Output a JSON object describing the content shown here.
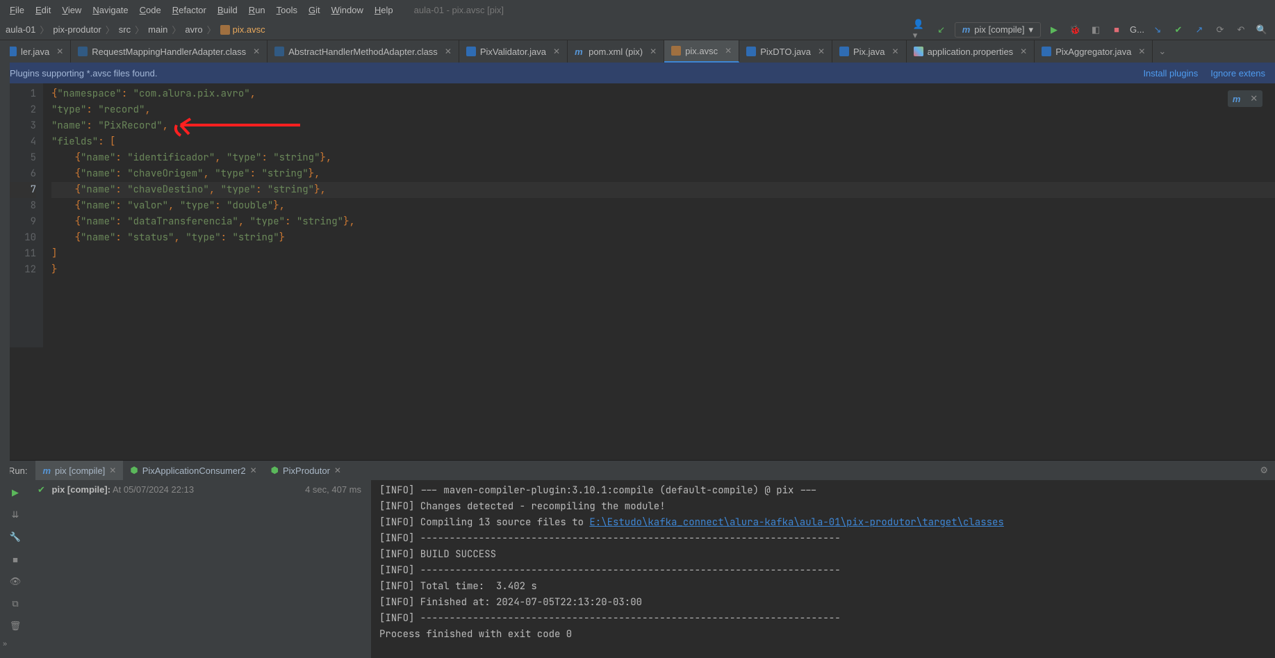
{
  "menubar": {
    "items": [
      "File",
      "Edit",
      "View",
      "Navigate",
      "Code",
      "Refactor",
      "Build",
      "Run",
      "Tools",
      "Git",
      "Window",
      "Help"
    ],
    "title": "aula-01 - pix.avsc [pix]"
  },
  "breadcrumbs": {
    "items": [
      "aula-01",
      "pix-produtor",
      "src",
      "main",
      "avro",
      "pix.avsc"
    ]
  },
  "run_config": {
    "label": "pix [compile]"
  },
  "toolbar_dropdown": "G...",
  "tabs": [
    {
      "label": "ler.java"
    },
    {
      "label": "RequestMappingHandlerAdapter.class"
    },
    {
      "label": "AbstractHandlerMethodAdapter.class"
    },
    {
      "label": "PixValidator.java"
    },
    {
      "label": "pom.xml (pix)"
    },
    {
      "label": "pix.avsc",
      "active": true
    },
    {
      "label": "PixDTO.java"
    },
    {
      "label": "Pix.java"
    },
    {
      "label": "application.properties"
    },
    {
      "label": "PixAggregator.java"
    }
  ],
  "banner": {
    "text": "Plugins supporting *.avsc files found.",
    "install": "Install plugins",
    "ignore": "Ignore extens"
  },
  "editor": {
    "lines": [
      {
        "n": 1,
        "segs": [
          [
            "pun",
            "{"
          ],
          [
            "str",
            "\"namespace\""
          ],
          [
            "pun",
            ": "
          ],
          [
            "str",
            "\"com.alura.pix.avro\""
          ],
          [
            "pun",
            ","
          ]
        ]
      },
      {
        "n": 2,
        "segs": [
          [
            "str",
            "\"type\""
          ],
          [
            "pun",
            ": "
          ],
          [
            "str",
            "\"record\""
          ],
          [
            "pun",
            ","
          ]
        ]
      },
      {
        "n": 3,
        "segs": [
          [
            "str",
            "\"name\""
          ],
          [
            "pun",
            ": "
          ],
          [
            "str",
            "\"PixRecord\""
          ],
          [
            "pun",
            ","
          ]
        ]
      },
      {
        "n": 4,
        "segs": [
          [
            "str",
            "\"fields\""
          ],
          [
            "pun",
            ": ["
          ]
        ]
      },
      {
        "n": 5,
        "segs": [
          [
            "plain",
            "    "
          ],
          [
            "pun",
            "{"
          ],
          [
            "str",
            "\"name\""
          ],
          [
            "pun",
            ": "
          ],
          [
            "str",
            "\"identificador\""
          ],
          [
            "pun",
            ", "
          ],
          [
            "str",
            "\"type\""
          ],
          [
            "pun",
            ": "
          ],
          [
            "str",
            "\"string\""
          ],
          [
            "pun",
            "},"
          ]
        ]
      },
      {
        "n": 6,
        "segs": [
          [
            "plain",
            "    "
          ],
          [
            "pun",
            "{"
          ],
          [
            "str",
            "\"name\""
          ],
          [
            "pun",
            ": "
          ],
          [
            "str",
            "\"chaveOrigem\""
          ],
          [
            "pun",
            ", "
          ],
          [
            "str",
            "\"type\""
          ],
          [
            "pun",
            ": "
          ],
          [
            "str",
            "\"string\""
          ],
          [
            "pun",
            "},"
          ]
        ]
      },
      {
        "n": 7,
        "hl": true,
        "segs": [
          [
            "plain",
            "    "
          ],
          [
            "pun",
            "{"
          ],
          [
            "str",
            "\"name\""
          ],
          [
            "pun",
            ": "
          ],
          [
            "str",
            "\"chaveDestino\""
          ],
          [
            "pun",
            ", "
          ],
          [
            "str",
            "\"type\""
          ],
          [
            "pun",
            ": "
          ],
          [
            "str",
            "\"string\""
          ],
          [
            "pun",
            "},"
          ]
        ]
      },
      {
        "n": 8,
        "segs": [
          [
            "plain",
            "    "
          ],
          [
            "pun",
            "{"
          ],
          [
            "str",
            "\"name\""
          ],
          [
            "pun",
            ": "
          ],
          [
            "str",
            "\"valor\""
          ],
          [
            "pun",
            ", "
          ],
          [
            "str",
            "\"type\""
          ],
          [
            "pun",
            ": "
          ],
          [
            "str",
            "\"double\""
          ],
          [
            "pun",
            "},"
          ]
        ]
      },
      {
        "n": 9,
        "segs": [
          [
            "plain",
            "    "
          ],
          [
            "pun",
            "{"
          ],
          [
            "str",
            "\"name\""
          ],
          [
            "pun",
            ": "
          ],
          [
            "str",
            "\"dataTransferencia\""
          ],
          [
            "pun",
            ", "
          ],
          [
            "str",
            "\"type\""
          ],
          [
            "pun",
            ": "
          ],
          [
            "str",
            "\"string\""
          ],
          [
            "pun",
            "},"
          ]
        ]
      },
      {
        "n": 10,
        "segs": [
          [
            "plain",
            "    "
          ],
          [
            "pun",
            "{"
          ],
          [
            "str",
            "\"name\""
          ],
          [
            "pun",
            ": "
          ],
          [
            "str",
            "\"status\""
          ],
          [
            "pun",
            ", "
          ],
          [
            "str",
            "\"type\""
          ],
          [
            "pun",
            ": "
          ],
          [
            "str",
            "\"string\""
          ],
          [
            "pun",
            "}"
          ]
        ]
      },
      {
        "n": 11,
        "segs": [
          [
            "pun",
            "]"
          ]
        ]
      },
      {
        "n": 12,
        "segs": [
          [
            "pun",
            "}"
          ]
        ]
      }
    ]
  },
  "run": {
    "label": "Run:",
    "tabs": [
      {
        "label": "pix [compile]",
        "icon": "m",
        "active": true
      },
      {
        "label": "PixApplicationConsumer2",
        "icon": "sb"
      },
      {
        "label": "PixProdutor",
        "icon": "sb"
      }
    ],
    "tree": {
      "title": "pix [compile]:",
      "status": "At 05/07/2024 22:13",
      "elapsed": "4 sec, 407 ms"
    },
    "console": [
      {
        "t": "[INFO] --- maven-compiler-plugin:3.10.1:compile (default-compile) @ pix ---"
      },
      {
        "t": "[INFO] Changes detected - recompiling the module!"
      },
      {
        "prefix": "[INFO] Compiling 13 source files to ",
        "link": "E:\\Estudo\\kafka_connect\\alura-kafka\\aula-01\\pix-produtor\\target\\classes"
      },
      {
        "t": "[INFO] ------------------------------------------------------------------------"
      },
      {
        "t": "[INFO] BUILD SUCCESS"
      },
      {
        "t": "[INFO] ------------------------------------------------------------------------"
      },
      {
        "t": "[INFO] Total time:  3.402 s"
      },
      {
        "t": "[INFO] Finished at: 2024-07-05T22:13:20-03:00"
      },
      {
        "t": "[INFO] ------------------------------------------------------------------------"
      },
      {
        "t": ""
      },
      {
        "t": "Process finished with exit code 0"
      }
    ]
  }
}
